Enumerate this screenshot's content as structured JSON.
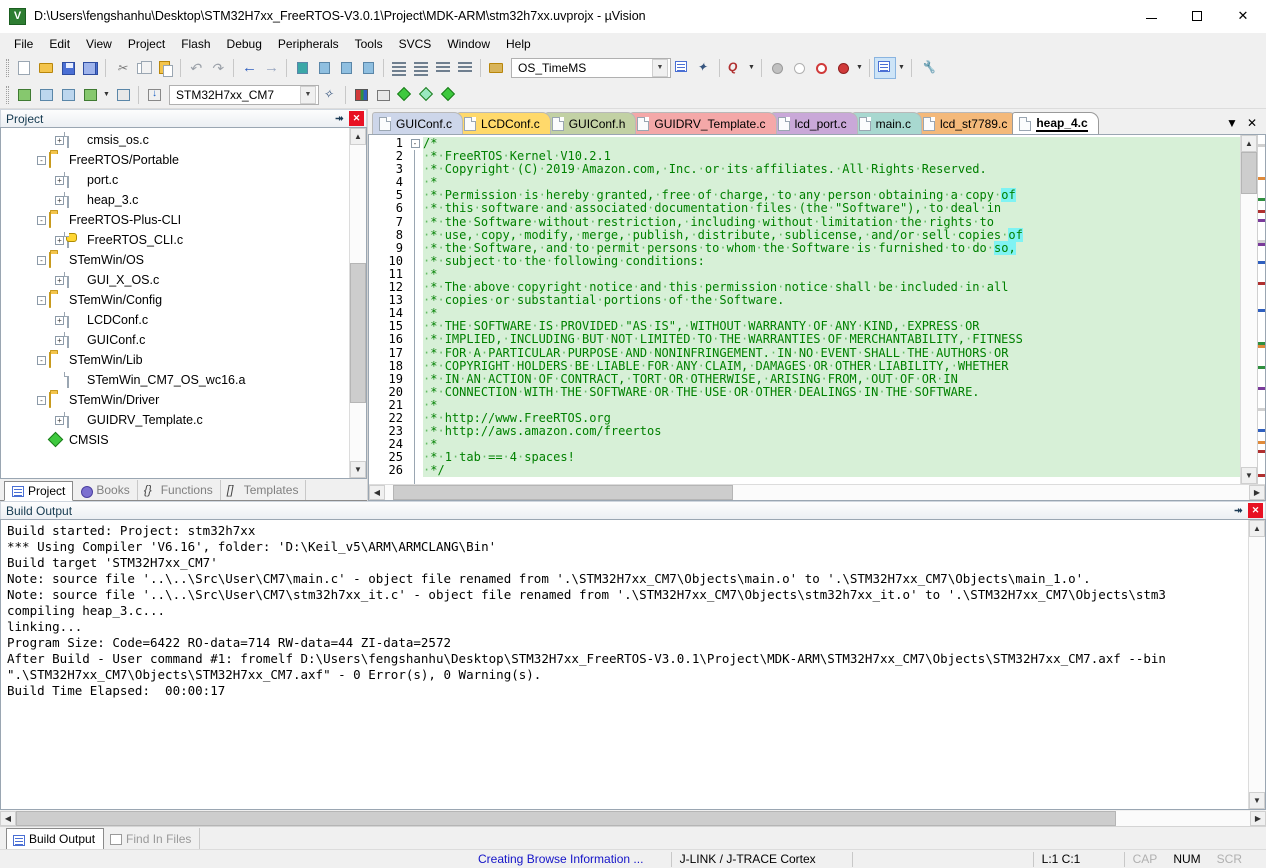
{
  "window": {
    "title": "D:\\Users\\fengshanhu\\Desktop\\STM32H7xx_FreeRTOS-V3.0.1\\Project\\MDK-ARM\\stm32h7xx.uvprojx - µVision",
    "app_icon": "uvision-icon",
    "minimize": "–",
    "maximize": "□",
    "close": "✕"
  },
  "menubar": {
    "items": [
      "File",
      "Edit",
      "View",
      "Project",
      "Flash",
      "Debug",
      "Peripherals",
      "Tools",
      "SVCS",
      "Window",
      "Help"
    ]
  },
  "toolbar1": {
    "buttons": [
      {
        "name": "new-file-icon",
        "glyph": ""
      },
      {
        "name": "open-file-icon",
        "glyph": ""
      },
      {
        "name": "save-icon",
        "glyph": ""
      },
      {
        "name": "save-all-icon",
        "glyph": ""
      },
      {
        "name": "cut-icon",
        "glyph": "✂"
      },
      {
        "name": "copy-icon",
        "glyph": ""
      },
      {
        "name": "paste-icon",
        "glyph": ""
      },
      {
        "name": "undo-icon",
        "glyph": "↶"
      },
      {
        "name": "redo-icon",
        "glyph": "↷"
      },
      {
        "name": "navigate-back-icon",
        "glyph": "←"
      },
      {
        "name": "navigate-forward-icon",
        "glyph": "→"
      },
      {
        "name": "toggle-bookmark-icon",
        "glyph": ""
      },
      {
        "name": "next-bookmark-icon",
        "glyph": ""
      },
      {
        "name": "previous-bookmark-icon",
        "glyph": ""
      },
      {
        "name": "clear-bookmarks-icon",
        "glyph": ""
      },
      {
        "name": "indent-right-icon",
        "glyph": ""
      },
      {
        "name": "indent-left-icon",
        "glyph": ""
      },
      {
        "name": "comment-block-icon",
        "glyph": ""
      },
      {
        "name": "uncomment-block-icon",
        "glyph": ""
      }
    ],
    "os_combo": {
      "value": "OS_TimeMS",
      "arrow": "▼"
    },
    "insert_tracepoint": "insert-tracepoint-icon",
    "bookmark_nav": "bookmark-nav-icon",
    "find_combo_arrow": "▼",
    "breakpoint_icons": [
      "breakpoint-gray-icon",
      "breakpoint-hollow-icon",
      "breakpoint-disable-icon",
      "breakpoint-kill-icon"
    ],
    "window_toggle": "window-layout-icon",
    "configure_icon": "configure-wrench-icon"
  },
  "toolbar2": {
    "buttons": [
      {
        "name": "translate-icon"
      },
      {
        "name": "build-icon"
      },
      {
        "name": "rebuild-icon"
      },
      {
        "name": "batch-build-icon"
      },
      {
        "name": "stop-build-icon"
      },
      {
        "name": "download-icon"
      }
    ],
    "target_combo": {
      "value": "STM32H7xx_CM7",
      "arrow": "▼"
    },
    "target_options": [
      "STM32H7xx_CM7"
    ],
    "manage_icons": [
      "magic-wand-icon",
      "manage-runtime-env-icon",
      "select-software-packs-icon",
      "pack-installer-icon",
      "manage-project-items-icon",
      "package-icon"
    ]
  },
  "project_panel": {
    "caption": "Project",
    "pin_glyph": "⯮",
    "close_glyph": "✕",
    "tree": [
      {
        "indent": 3,
        "expander": "+",
        "icon": "file-icon",
        "label": "cmsis_os.c"
      },
      {
        "indent": 2,
        "expander": "-",
        "icon": "folder-icon",
        "label": "FreeRTOS/Portable"
      },
      {
        "indent": 3,
        "expander": "+",
        "icon": "file-icon",
        "label": "port.c"
      },
      {
        "indent": 3,
        "expander": "+",
        "icon": "file-icon",
        "label": "heap_3.c"
      },
      {
        "indent": 2,
        "expander": "-",
        "icon": "folder-icon",
        "label": "FreeRTOS-Plus-CLI"
      },
      {
        "indent": 3,
        "expander": "+",
        "icon": "file-key-icon",
        "label": "FreeRTOS_CLI.c"
      },
      {
        "indent": 2,
        "expander": "-",
        "icon": "folder-icon",
        "label": "STemWin/OS"
      },
      {
        "indent": 3,
        "expander": "+",
        "icon": "file-icon",
        "label": "GUI_X_OS.c"
      },
      {
        "indent": 2,
        "expander": "-",
        "icon": "folder-icon",
        "label": "STemWin/Config"
      },
      {
        "indent": 3,
        "expander": "+",
        "icon": "file-icon",
        "label": "LCDConf.c"
      },
      {
        "indent": 3,
        "expander": "+",
        "icon": "file-icon",
        "label": "GUIConf.c"
      },
      {
        "indent": 2,
        "expander": "-",
        "icon": "folder-icon",
        "label": "STemWin/Lib"
      },
      {
        "indent": 3,
        "expander": "",
        "icon": "file-icon",
        "label": "STemWin_CM7_OS_wc16.a"
      },
      {
        "indent": 2,
        "expander": "-",
        "icon": "folder-icon",
        "label": "STemWin/Driver"
      },
      {
        "indent": 3,
        "expander": "+",
        "icon": "file-icon",
        "label": "GUIDRV_Template.c"
      },
      {
        "indent": 2,
        "expander": "",
        "icon": "cmsis-icon",
        "label": "CMSIS"
      }
    ],
    "tabs": [
      {
        "label": "Project",
        "icon": "project-icon",
        "active": true
      },
      {
        "label": "Books",
        "icon": "books-icon",
        "active": false
      },
      {
        "label": "Functions",
        "icon": "functions-icon",
        "active": false
      },
      {
        "label": "Templates",
        "icon": "templates-icon",
        "active": false
      }
    ]
  },
  "editor": {
    "tabs": [
      {
        "label": "GUIConf.c",
        "color": "#cdd6ea",
        "active": false
      },
      {
        "label": "LCDConf.c",
        "color": "#ffd96b",
        "active": false
      },
      {
        "label": "GUIConf.h",
        "color": "#c2d1a4",
        "active": false
      },
      {
        "label": "GUIDRV_Template.c",
        "color": "#f4a8a8",
        "active": false
      },
      {
        "label": "lcd_port.c",
        "color": "#c9a8d8",
        "active": false
      },
      {
        "label": "main.c",
        "color": "#a8d8d0",
        "active": false
      },
      {
        "label": "lcd_st7789.c",
        "color": "#f4b97a",
        "active": false
      },
      {
        "label": "heap_4.c",
        "color": "#ffffff",
        "active": true
      }
    ],
    "tab_menu_glyph": "▼",
    "tab_close_glyph": "✕",
    "first_line_number": 1,
    "lines": [
      {
        "n": 1,
        "text": "/*",
        "fold": "-"
      },
      {
        "n": 2,
        "text": " * FreeRTOS Kernel V10.2.1"
      },
      {
        "n": 3,
        "text": " * Copyright (C) 2019 Amazon.com, Inc. or its affiliates. All Rights Reserved."
      },
      {
        "n": 4,
        "text": " *"
      },
      {
        "n": 5,
        "text": " * Permission is hereby granted, free of charge, to any person obtaining a copy of",
        "hl": [
          "of"
        ]
      },
      {
        "n": 6,
        "text": " * this software and associated documentation files (the \"Software\"), to deal in"
      },
      {
        "n": 7,
        "text": " * the Software without restriction, including without limitation the rights to"
      },
      {
        "n": 8,
        "text": " * use, copy, modify, merge, publish, distribute, sublicense, and/or sell copies of",
        "hl": [
          "of"
        ]
      },
      {
        "n": 9,
        "text": " * the Software, and to permit persons to whom the Software is furnished to do so,",
        "hl": [
          "so,"
        ]
      },
      {
        "n": 10,
        "text": " * subject to the following conditions:"
      },
      {
        "n": 11,
        "text": " *"
      },
      {
        "n": 12,
        "text": " * The above copyright notice and this permission notice shall be included in all"
      },
      {
        "n": 13,
        "text": " * copies or substantial portions of the Software."
      },
      {
        "n": 14,
        "text": " *"
      },
      {
        "n": 15,
        "text": " * THE SOFTWARE IS PROVIDED \"AS IS\", WITHOUT WARRANTY OF ANY KIND, EXPRESS OR"
      },
      {
        "n": 16,
        "text": " * IMPLIED, INCLUDING BUT NOT LIMITED TO THE WARRANTIES OF MERCHANTABILITY, FITNESS"
      },
      {
        "n": 17,
        "text": " * FOR A PARTICULAR PURPOSE AND NONINFRINGEMENT. IN NO EVENT SHALL THE AUTHORS OR"
      },
      {
        "n": 18,
        "text": " * COPYRIGHT HOLDERS BE LIABLE FOR ANY CLAIM, DAMAGES OR OTHER LIABILITY, WHETHER"
      },
      {
        "n": 19,
        "text": " * IN AN ACTION OF CONTRACT, TORT OR OTHERWISE, ARISING FROM, OUT OF OR IN"
      },
      {
        "n": 20,
        "text": " * CONNECTION WITH THE SOFTWARE OR THE USE OR OTHER DEALINGS IN THE SOFTWARE."
      },
      {
        "n": 21,
        "text": " *"
      },
      {
        "n": 22,
        "text": " * http://www.FreeRTOS.org"
      },
      {
        "n": 23,
        "text": " * http://aws.amazon.com/freertos"
      },
      {
        "n": 24,
        "text": " *"
      },
      {
        "n": 25,
        "text": " * 1 tab == 4 spaces!"
      },
      {
        "n": 26,
        "text": " */"
      }
    ]
  },
  "build_output": {
    "caption": "Build Output",
    "pin_glyph": "⯮",
    "close_glyph": "✕",
    "lines": [
      "Build started: Project: stm32h7xx",
      "*** Using Compiler 'V6.16', folder: 'D:\\Keil_v5\\ARM\\ARMCLANG\\Bin'",
      "Build target 'STM32H7xx_CM7'",
      "Note: source file '..\\..\\Src\\User\\CM7\\main.c' - object file renamed from '.\\STM32H7xx_CM7\\Objects\\main.o' to '.\\STM32H7xx_CM7\\Objects\\main_1.o'.",
      "Note: source file '..\\..\\Src\\User\\CM7\\stm32h7xx_it.c' - object file renamed from '.\\STM32H7xx_CM7\\Objects\\stm32h7xx_it.o' to '.\\STM32H7xx_CM7\\Objects\\stm3",
      "compiling heap_3.c...",
      "linking...",
      "Program Size: Code=6422 RO-data=714 RW-data=44 ZI-data=2572",
      "After Build - User command #1: fromelf D:\\Users\\fengshanhu\\Desktop\\STM32H7xx_FreeRTOS-V3.0.1\\Project\\MDK-ARM\\STM32H7xx_CM7\\Objects\\STM32H7xx_CM7.axf --bin",
      "\".\\STM32H7xx_CM7\\Objects\\STM32H7xx_CM7.axf\" - 0 Error(s), 0 Warning(s).",
      "Build Time Elapsed:  00:00:17"
    ],
    "tabs": [
      {
        "label": "Build Output",
        "icon": "build-output-icon",
        "active": true
      },
      {
        "label": "Find In Files",
        "icon": "find-in-files-icon",
        "active": false
      }
    ]
  },
  "statusbar": {
    "message": "Creating Browse Information ...",
    "debugger": "J-LINK / J-TRACE Cortex",
    "cursor": "L:1 C:1",
    "caps": "CAP",
    "num": "NUM",
    "scroll": "SCR"
  }
}
